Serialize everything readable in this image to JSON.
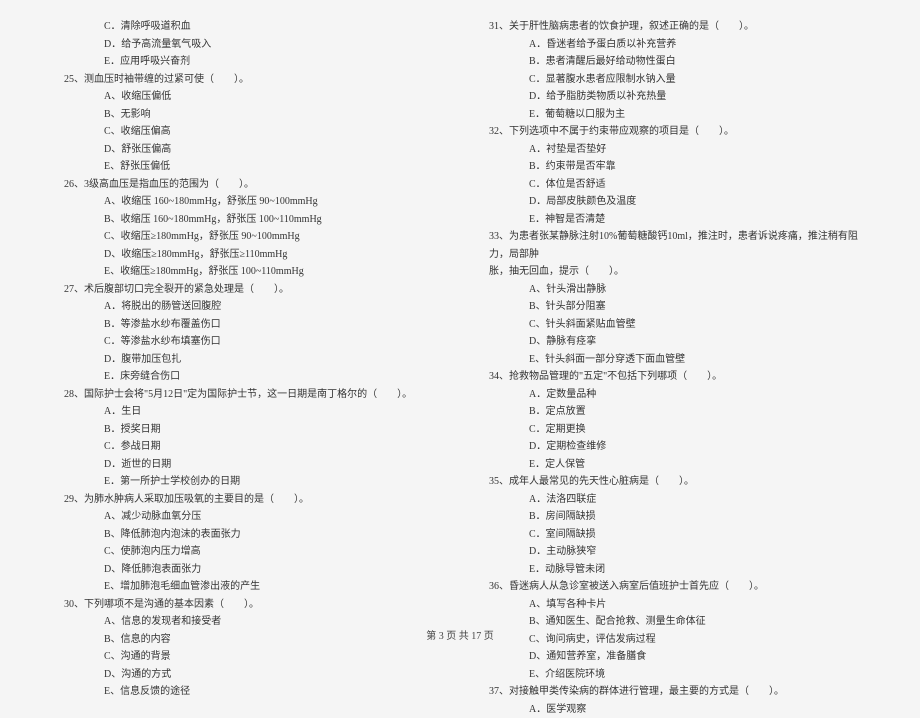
{
  "left": {
    "pre_options": [
      "C．清除呼吸道积血",
      "D．给予高流量氧气吸入",
      "E．应用呼吸兴奋剂"
    ],
    "items": [
      {
        "num": "25、",
        "stem": "测血压时袖带缠的过紧可使（　　）。",
        "options": [
          "A、收缩压偏低",
          "B、无影响",
          "C、收缩压偏高",
          "D、舒张压偏高",
          "E、舒张压偏低"
        ]
      },
      {
        "num": "26、",
        "stem": "3级高血压是指血压的范围为（　　）。",
        "options": [
          "A、收缩压 160~180mmHg，舒张压 90~100mmHg",
          "B、收缩压 160~180mmHg，舒张压 100~110mmHg",
          "C、收缩压≥180mmHg，舒张压 90~100mmHg",
          "D、收缩压≥180mmHg，舒张压≥110mmHg",
          "E、收缩压≥180mmHg，舒张压 100~110mmHg"
        ]
      },
      {
        "num": "27、",
        "stem": "术后腹部切口完全裂开的紧急处理是（　　）。",
        "options": [
          "A．将脱出的肠管送回腹腔",
          "B．等渗盐水纱布覆盖伤口",
          "C．等渗盐水纱布填塞伤口",
          "D．腹带加压包扎",
          "E．床旁缝合伤口"
        ]
      },
      {
        "num": "28、",
        "stem": "国际护士会将\"5月12日\"定为国际护士节，这一日期是南丁格尔的（　　）。",
        "options": [
          "A．生日",
          "B．授奖日期",
          "C．参战日期",
          "D．逝世的日期",
          "E．第一所护士学校创办的日期"
        ]
      },
      {
        "num": "29、",
        "stem": "为肺水肿病人采取加压吸氧的主要目的是（　　）。",
        "options": [
          "A、减少动脉血氧分压",
          "B、降低肺泡内泡沫的表面张力",
          "C、使肺泡内压力增高",
          "D、降低肺泡表面张力",
          "E、增加肺泡毛细血管渗出液的产生"
        ]
      },
      {
        "num": "30、",
        "stem": "下列哪项不是沟通的基本因素（　　）。",
        "options": [
          "A、信息的发现者和接受者",
          "B、信息的内容",
          "C、沟通的背景",
          "D、沟通的方式",
          "E、信息反馈的途径"
        ]
      }
    ]
  },
  "right": {
    "items": [
      {
        "num": "31、",
        "stem": "关于肝性脑病患者的饮食护理，叙述正确的是（　　）。",
        "options": [
          "A．昏迷者给予蛋白质以补充营养",
          "B．患者清醒后最好给动物性蛋白",
          "C．显著腹水患者应限制水钠入量",
          "D．给予脂肪类物质以补充热量",
          "E．葡萄糖以口服为主"
        ]
      },
      {
        "num": "32、",
        "stem": "下列选项中不属于约束带应观察的项目是（　　）。",
        "options": [
          "A．衬垫是否垫好",
          "B．约束带是否牢靠",
          "C．体位是否舒适",
          "D．局部皮肤颜色及温度",
          "E．神智是否清楚"
        ]
      },
      {
        "num": "33、",
        "stem": "为患者张某静脉注射10%葡萄糖酸钙10ml，推注时，患者诉说疼痛，推注稍有阻力，局部肿",
        "cont": "胀，抽无回血，提示（　　）。",
        "options": [
          "A、针头滑出静脉",
          "B、针头部分阻塞",
          "C、针头斜面紧贴血管壁",
          "D、静脉有痉挛",
          "E、针头斜面一部分穿透下面血管壁"
        ]
      },
      {
        "num": "34、",
        "stem": "抢救物品管理的\"五定\"不包括下列哪项（　　）。",
        "options": [
          "A．定数量品种",
          "B．定点放置",
          "C．定期更换",
          "D．定期检查维修",
          "E．定人保管"
        ]
      },
      {
        "num": "35、",
        "stem": "成年人最常见的先天性心脏病是（　　）。",
        "options": [
          "A．法洛四联症",
          "B．房间隔缺损",
          "C．室间隔缺损",
          "D．主动脉狭窄",
          "E．动脉导管未闭"
        ]
      },
      {
        "num": "36、",
        "stem": "昏迷病人从急诊室被送入病室后值班护士首先应（　　）。",
        "options": [
          "A、填写各种卡片",
          "B、通知医生、配合抢救、测量生命体征",
          "C、询问病史，评估发病过程",
          "D、通知营养室，准备膳食",
          "E、介绍医院环境"
        ]
      },
      {
        "num": "37、",
        "stem": "对接触甲类传染病的群体进行管理，最主要的方式是（　　）。",
        "options_partial": [
          "A．医学观察"
        ]
      }
    ]
  },
  "footer": "第 3 页 共 17 页"
}
